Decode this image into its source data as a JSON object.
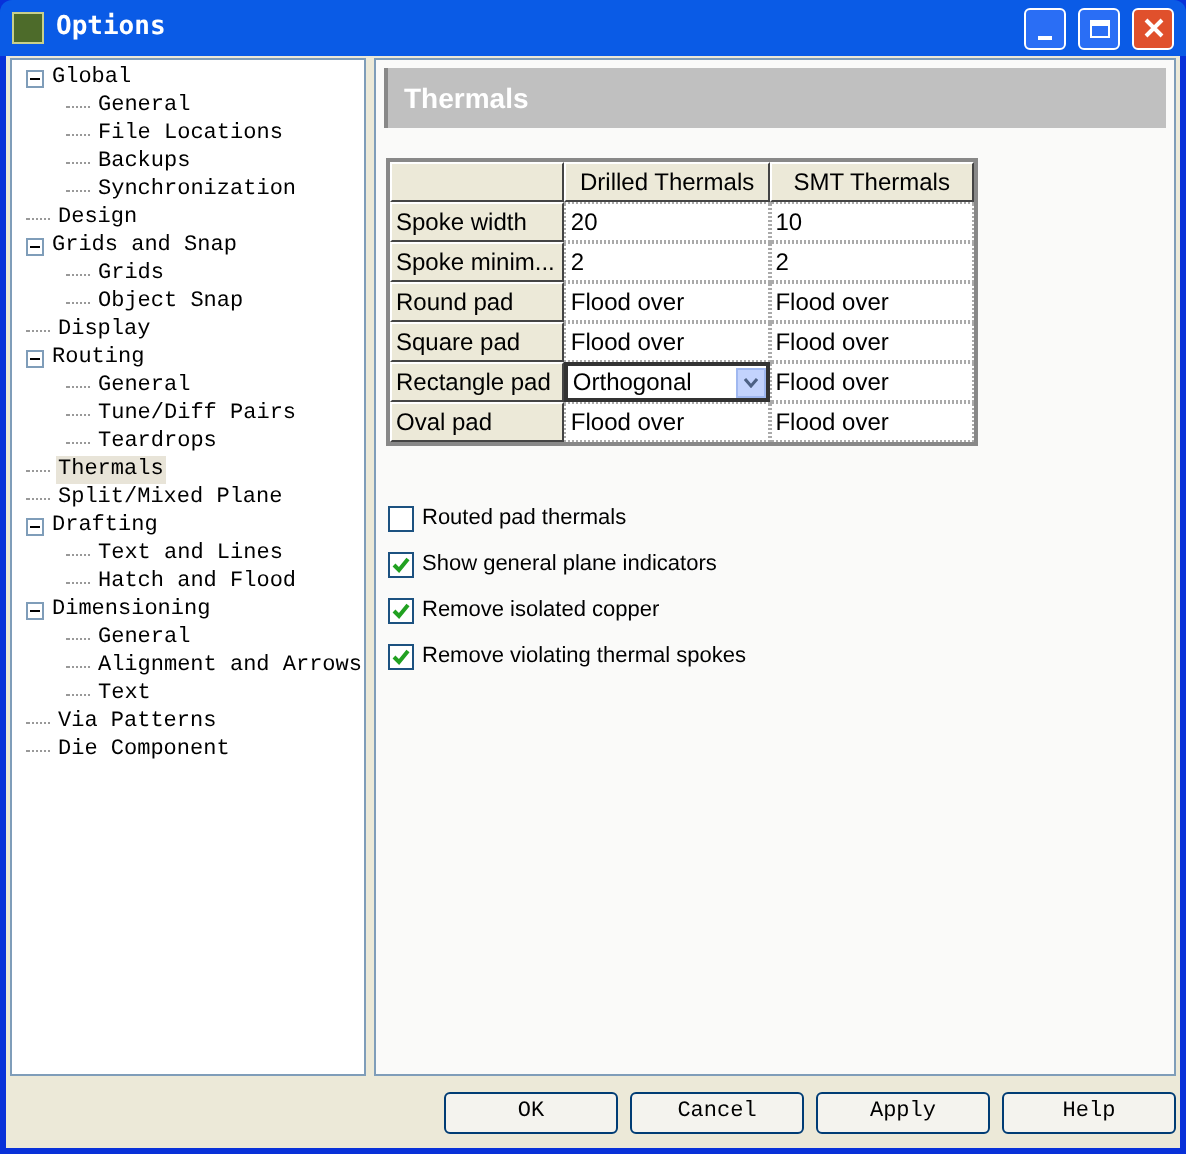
{
  "window": {
    "title": "Options"
  },
  "tree": [
    {
      "label": "Global",
      "expanded": true,
      "selected": false,
      "children": [
        {
          "label": "General",
          "selected": false
        },
        {
          "label": "File Locations",
          "selected": false
        },
        {
          "label": "Backups",
          "selected": false
        },
        {
          "label": "Synchronization",
          "selected": false
        }
      ]
    },
    {
      "label": "Design",
      "selected": false
    },
    {
      "label": "Grids and Snap",
      "expanded": true,
      "selected": false,
      "children": [
        {
          "label": "Grids",
          "selected": false
        },
        {
          "label": "Object Snap",
          "selected": false
        }
      ]
    },
    {
      "label": "Display",
      "selected": false
    },
    {
      "label": "Routing",
      "expanded": true,
      "selected": false,
      "children": [
        {
          "label": "General",
          "selected": false
        },
        {
          "label": "Tune/Diff Pairs",
          "selected": false
        },
        {
          "label": "Teardrops",
          "selected": false
        }
      ]
    },
    {
      "label": "Thermals",
      "selected": true
    },
    {
      "label": "Split/Mixed Plane",
      "selected": false
    },
    {
      "label": "Drafting",
      "expanded": true,
      "selected": false,
      "children": [
        {
          "label": "Text and Lines",
          "selected": false
        },
        {
          "label": "Hatch and Flood",
          "selected": false
        }
      ]
    },
    {
      "label": "Dimensioning",
      "expanded": true,
      "selected": false,
      "children": [
        {
          "label": "General",
          "selected": false
        },
        {
          "label": "Alignment and Arrows",
          "selected": false
        },
        {
          "label": "Text",
          "selected": false
        }
      ]
    },
    {
      "label": "Via Patterns",
      "selected": false
    },
    {
      "label": "Die Component",
      "selected": false
    }
  ],
  "panel": {
    "title": "Thermals"
  },
  "table": {
    "columns": [
      "Drilled Thermals",
      "SMT Thermals"
    ],
    "rows": [
      {
        "label": "Spoke width",
        "cells": [
          {
            "value": "20",
            "kind": "text"
          },
          {
            "value": "10",
            "kind": "text"
          }
        ]
      },
      {
        "label": "Spoke minim...",
        "cells": [
          {
            "value": "2",
            "kind": "text"
          },
          {
            "value": "2",
            "kind": "text"
          }
        ]
      },
      {
        "label": "Round pad",
        "cells": [
          {
            "value": "Flood over",
            "kind": "text"
          },
          {
            "value": "Flood over",
            "kind": "text"
          }
        ]
      },
      {
        "label": "Square pad",
        "cells": [
          {
            "value": "Flood over",
            "kind": "text"
          },
          {
            "value": "Flood over",
            "kind": "text"
          }
        ]
      },
      {
        "label": "Rectangle pad",
        "cells": [
          {
            "value": "Orthogonal",
            "kind": "dropdown"
          },
          {
            "value": "Flood over",
            "kind": "text"
          }
        ]
      },
      {
        "label": "Oval pad",
        "cells": [
          {
            "value": "Flood over",
            "kind": "text"
          },
          {
            "value": "Flood over",
            "kind": "text"
          }
        ]
      }
    ]
  },
  "options": [
    {
      "label": "Routed pad thermals",
      "checked": false
    },
    {
      "label": "Show general plane indicators",
      "checked": true
    },
    {
      "label": "Remove isolated copper",
      "checked": true
    },
    {
      "label": "Remove violating thermal spokes",
      "checked": true
    }
  ],
  "buttons": [
    "OK",
    "Cancel",
    "Apply",
    "Help"
  ]
}
